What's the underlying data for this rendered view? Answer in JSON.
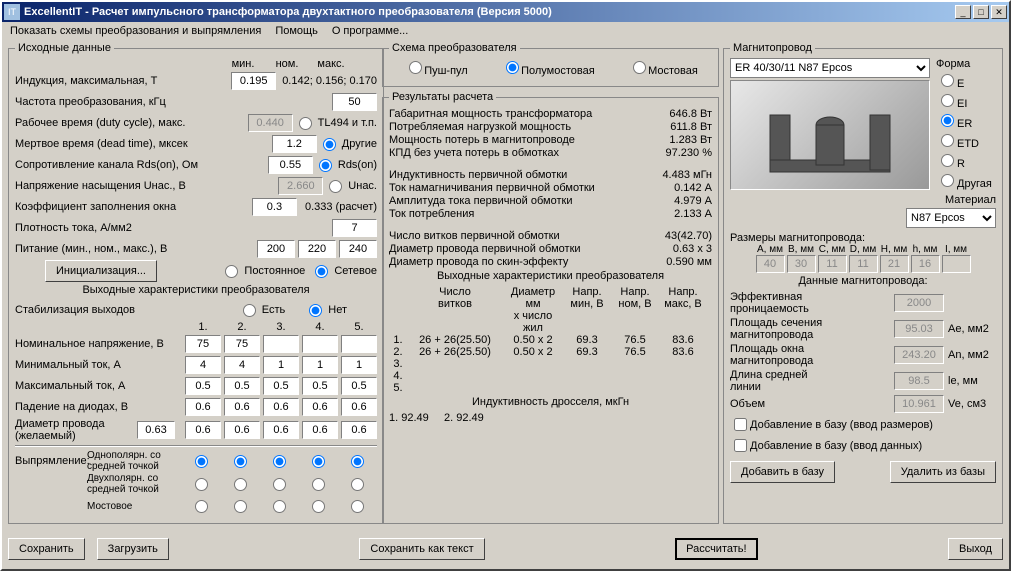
{
  "title": "ExcellentIT - Расчет импульсного трансформатора двухтактного преобразователя (Версия 5000)",
  "menu": {
    "schemes": "Показать схемы преобразования и выпрямления",
    "help": "Помощь",
    "about": "О программе..."
  },
  "groups": {
    "input": "Исходные данные",
    "scheme": "Схема преобразователя",
    "results": "Результаты расчета",
    "core": "Магнитопровод",
    "out_char": "Выходные характеристики преобразователя"
  },
  "hdr": {
    "min": "мин.",
    "nom": "ном.",
    "max": "макс."
  },
  "input": {
    "induction": "Индукция, максимальная, Т",
    "induction_val": "0.195",
    "induction_range": "0.142; 0.156; 0.170",
    "freq": "Частота преобразования, кГц",
    "freq_val": "50",
    "duty": "Рабочее время (duty cycle), макс.",
    "duty_val": "0.440",
    "dead": "Мертвое время (dead time), мксек",
    "dead_val": "1.2",
    "rds": "Сопротивление канала Rds(on), Ом",
    "rds_val": "0.55",
    "usat": "Напряжение насыщения Uнас., В",
    "usat_val": "2.660",
    "fill": "Коэффициент заполнения окна",
    "fill_val": "0.3",
    "fill_calc": "0.333 (расчет)",
    "dens": "Плотность тока, А/мм2",
    "dens_val": "7",
    "supply": "Питание (мин., ном., макс.), В",
    "supply_min": "200",
    "supply_nom": "220",
    "supply_max": "240",
    "init_btn": "Инициализация...",
    "opt_tl494": "TL494 и т.п.",
    "opt_other": "Другие",
    "opt_rds": "Rds(on)",
    "opt_usat": "Uнас.",
    "opt_dc": "Постоянное",
    "opt_ac": "Сетевое"
  },
  "scheme": {
    "push": "Пуш-пул",
    "half": "Полумостовая",
    "full": "Мостовая"
  },
  "out": {
    "stab": "Стабилизация выходов",
    "yes": "Есть",
    "no": "Нет",
    "vnom": "Номинальное напряжение, В",
    "imin": "Минимальный ток, А",
    "imax": "Максимальный ток, А",
    "vdrop": "Падение на диодах, В",
    "dwire": "Диаметр провода\n(желаемый)",
    "dwire_val": "0.63",
    "rect": "Выпрямление:",
    "r1": "Однополярн. со средней точкой",
    "r2": "Двухполярн. со средней точкой",
    "r3": "Мостовое",
    "vals": {
      "vnom": [
        "75",
        "75",
        "",
        "",
        ""
      ],
      "imin": [
        "4",
        "4",
        "1",
        "1",
        "1"
      ],
      "imax": [
        "0.5",
        "0.5",
        "0.5",
        "0.5",
        "0.5"
      ],
      "vdrop": [
        "0.6",
        "0.6",
        "0.6",
        "0.6",
        "0.6"
      ],
      "dwire": [
        "0.6",
        "0.6",
        "0.6",
        "0.6",
        "0.6"
      ]
    }
  },
  "results": {
    "gab": "Габаритная мощность трансформатора",
    "gab_v": "646.8 Вт",
    "load": "Потребляемая нагрузкой мощность",
    "load_v": "611.8 Вт",
    "loss": "Мощность потерь в магнитопроводе",
    "loss_v": "1.283 Вт",
    "eff": "КПД без учета потерь в обмотках",
    "eff_v": "97.230 %",
    "lpri": "Индуктивность первичной обмотки",
    "lpri_v": "4.483 мГн",
    "imag": "Ток намагничивания первичной обмотки",
    "imag_v": "0.142 А",
    "iamp": "Амплитуда тока первичной обмотки",
    "iamp_v": "4.979 А",
    "icon": "Ток потребления",
    "icon_v": "2.133 А",
    "turns": "Число витков первичной обмотки",
    "turns_v": "43(42.70)",
    "dpri": "Диаметр провода первичной обмотки",
    "dpri_v": "0.63 x 3",
    "dskin": "Диаметр провода по скин-эффекту",
    "dskin_v": "0.590 мм",
    "out_hdr": "Выходные характеристики преобразователя",
    "h_turns": "Число\nвитков",
    "h_diam": "Диаметр мм\nx число жил",
    "h_vmin": "Напр.\nмин, В",
    "h_vnom": "Напр.\nном, В",
    "h_vmax": "Напр.\nмакс, В",
    "rows": [
      {
        "n": "1.",
        "t": "26 + 26(25.50)",
        "d": "0.50 x 2",
        "vmin": "69.3",
        "vnom": "76.5",
        "vmax": "83.6"
      },
      {
        "n": "2.",
        "t": "26 + 26(25.50)",
        "d": "0.50 x 2",
        "vmin": "69.3",
        "vnom": "76.5",
        "vmax": "83.6"
      },
      {
        "n": "3.",
        "t": "",
        "d": "",
        "vmin": "",
        "vnom": "",
        "vmax": ""
      },
      {
        "n": "4.",
        "t": "",
        "d": "",
        "vmin": "",
        "vnom": "",
        "vmax": ""
      },
      {
        "n": "5.",
        "t": "",
        "d": "",
        "vmin": "",
        "vnom": "",
        "vmax": ""
      }
    ],
    "choke_hdr": "Индуктивность дросселя, мкГн",
    "choke": "1. 92.49     2. 92.49"
  },
  "core": {
    "list_val": "ER 40/30/11 N87 Epcos",
    "form": "Форма",
    "forms": {
      "e": "E",
      "ei": "EI",
      "er": "ER",
      "etd": "ETD",
      "r": "R",
      "other": "Другая"
    },
    "material": "Материал",
    "material_val": "N87 Epcos",
    "dims_lbl": "Размеры магнитопровода:",
    "dim_h": [
      "A, мм",
      "B, мм",
      "C, мм",
      "D, мм",
      "H, мм",
      "h, мм",
      "I, мм"
    ],
    "dims": [
      "40",
      "30",
      "11",
      "11",
      "21",
      "16",
      ""
    ],
    "data_lbl": "Данные магнитопровода:",
    "perm": "Эффективная\nпроницаемость",
    "perm_v": "2000",
    "ae": "Площадь сечения\nмагнитопровода",
    "ae_v": "95.03",
    "ae_u": "Ae, мм2",
    "an": "Площадь окна\nмагнитопровода",
    "an_v": "243.20",
    "an_u": "An, мм2",
    "le": "Длина средней\nлинии",
    "le_v": "98.5",
    "le_u": "le, мм",
    "ve": "Объем",
    "ve_v": "10.961",
    "ve_u": "Ve, см3",
    "chk1": "Добавление в базу (ввод размеров)",
    "chk2": "Добавление в базу (ввод данных)",
    "btn_add": "Добавить в базу",
    "btn_del": "Удалить из базы"
  },
  "btns": {
    "save": "Сохранить",
    "load": "Загрузить",
    "save_txt": "Сохранить как текст",
    "calc": "Рассчитать!",
    "exit": "Выход"
  }
}
